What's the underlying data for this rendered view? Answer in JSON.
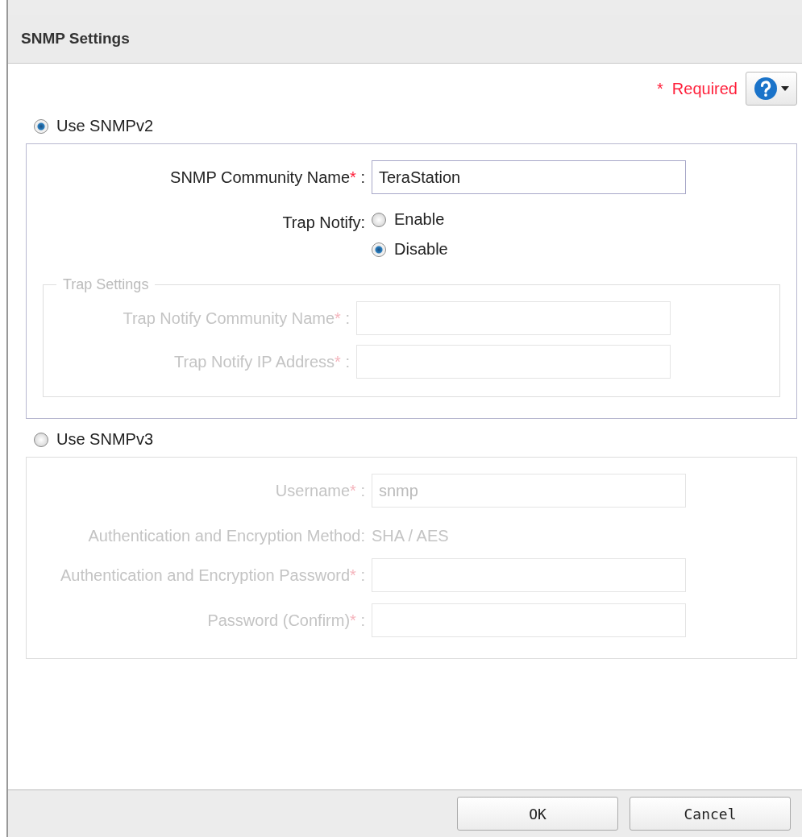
{
  "window": {
    "title": "SNMP Settings"
  },
  "required_note": {
    "mark": "*",
    "label": "Required"
  },
  "sections": [
    {
      "label": "Use SNMPv2",
      "selected": true,
      "disabled": false,
      "rows": [
        {
          "kind": "text",
          "label": "SNMP Community Name",
          "mark": "*",
          "colon": ":",
          "value": "TeraStation"
        },
        {
          "kind": "radio",
          "label": "Trap Notify:",
          "options": [
            {
              "label": "Enable",
              "selected": false
            },
            {
              "label": "Disable",
              "selected": true
            }
          ]
        },
        {
          "kind": "group",
          "legend": "Trap Settings",
          "disabled": true,
          "rows": [
            {
              "kind": "text",
              "label": "Trap Notify Community Name",
              "mark": "*",
              "colon": ":",
              "value": ""
            },
            {
              "kind": "text",
              "label": "Trap Notify IP Address",
              "mark": "*",
              "colon": ":",
              "value": ""
            }
          ]
        }
      ]
    },
    {
      "label": "Use SNMPv3",
      "selected": false,
      "disabled": true,
      "rows": [
        {
          "kind": "text",
          "label": "Username",
          "mark": "*",
          "colon": ":",
          "value": "snmp"
        },
        {
          "kind": "static",
          "label": "Authentication and Encryption Method:",
          "value": "SHA / AES"
        },
        {
          "kind": "text",
          "label": "Authentication and Encryption Password",
          "mark": "*",
          "colon": ":",
          "value": ""
        },
        {
          "kind": "text",
          "label": "Password (Confirm)",
          "mark": "*",
          "colon": ":",
          "value": ""
        }
      ]
    }
  ],
  "buttons": [
    {
      "label": "OK"
    },
    {
      "label": "Cancel"
    }
  ]
}
